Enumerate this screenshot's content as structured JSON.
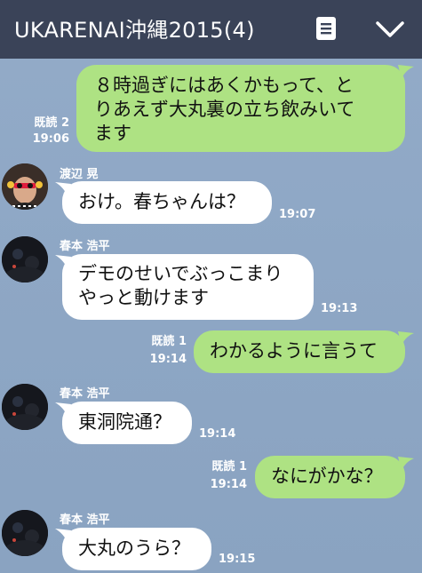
{
  "header": {
    "title": "UKARENAI沖縄2015(4)",
    "memo_icon": "memo-icon",
    "collapse_icon": "chevron-down-icon"
  },
  "messages": [
    {
      "side": "out",
      "lines": [
        "８時過ぎにはあくかもって、と",
        "りあえず大丸裏の立ち飲みいて",
        "ます"
      ],
      "read": "既読 2",
      "time": "19:06"
    },
    {
      "side": "in",
      "sender": "渡辺 晃",
      "text": "おけ。春ちゃんは？",
      "time": "19:07"
    },
    {
      "side": "in",
      "sender": "春本 浩平",
      "lines": [
        "デモのせいでぶっこまり",
        "やっと動けます"
      ],
      "time": "19:13"
    },
    {
      "side": "out",
      "text": "わかるように言うて",
      "read": "既読 1",
      "time": "19:14"
    },
    {
      "side": "in",
      "sender": "春本 浩平",
      "text": "東洞院通？",
      "time": "19:14"
    },
    {
      "side": "out",
      "text": "なにがかな？",
      "read": "既読 1",
      "time": "19:14"
    },
    {
      "side": "in",
      "sender": "春本 浩平",
      "text": "大丸のうら？",
      "time": "19:15"
    }
  ],
  "colors": {
    "header_bg": "#3a4358",
    "chat_bg": "#8ea7c5",
    "outgoing_bubble": "#aee283",
    "incoming_bubble": "#ffffff"
  }
}
